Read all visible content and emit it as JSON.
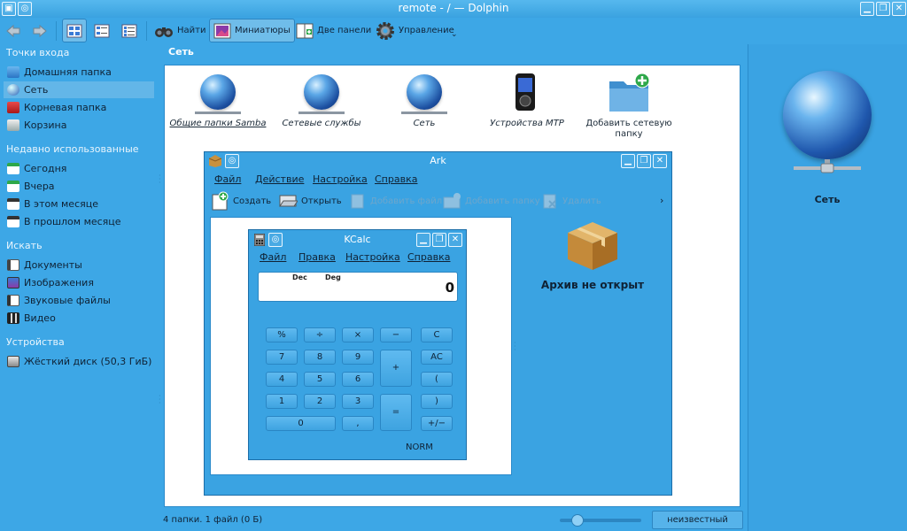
{
  "window": {
    "title": "remote - / — Dolphin"
  },
  "toolbar": {
    "find": "Найти",
    "preview": "Миниатюры",
    "split": "Две панели",
    "control": "Управление"
  },
  "places": {
    "sections": {
      "places": "Точки входа",
      "recent": "Недавно использованные",
      "search": "Искать",
      "devices": "Устройства"
    },
    "places_items": [
      "Домашняя папка",
      "Сеть",
      "Корневая папка",
      "Корзина"
    ],
    "recent_items": [
      "Сегодня",
      "Вчера",
      "В этом месяце",
      "В прошлом месяце"
    ],
    "search_items": [
      "Документы",
      "Изображения",
      "Звуковые файлы",
      "Видео"
    ],
    "device_items": [
      "Жёсткий диск (50,3 ГиБ)"
    ]
  },
  "view": {
    "location": "Сеть",
    "items": [
      "Общие папки Samba",
      "Сетевые службы",
      "Сеть",
      "Устройства MTP",
      "Добавить сетевую папку"
    ]
  },
  "status": {
    "text": "4 папки. 1 файл (0 Б)",
    "size_button": "неизвестный размер"
  },
  "info": {
    "name": "Сеть"
  },
  "ark": {
    "title": "Ark",
    "menu": [
      "Файл",
      "Действие",
      "Настройка",
      "Справка"
    ],
    "toolbar": [
      "Создать",
      "Открыть",
      "Добавить файл",
      "Добавить папку",
      "Удалить"
    ],
    "message": "Архив не открыт"
  },
  "kcalc": {
    "title": "KCalc",
    "menu": [
      "Файл",
      "Правка",
      "Настройка",
      "Справка"
    ],
    "indicators": [
      "Dec",
      "Deg"
    ],
    "display": "0",
    "keys": {
      "percent": "%",
      "divide": "÷",
      "multiply": "×",
      "minus": "−",
      "clear": "C",
      "k7": "7",
      "k8": "8",
      "k9": "9",
      "plus": "+",
      "all_clear": "AC",
      "k4": "4",
      "k5": "5",
      "k6": "6",
      "paren_open": "(",
      "k1": "1",
      "k2": "2",
      "k3": "3",
      "equals": "=",
      "paren_close": ")",
      "k0": "0",
      "decimal": ",",
      "plus_minus": "+/−"
    },
    "mode": "NORM"
  }
}
